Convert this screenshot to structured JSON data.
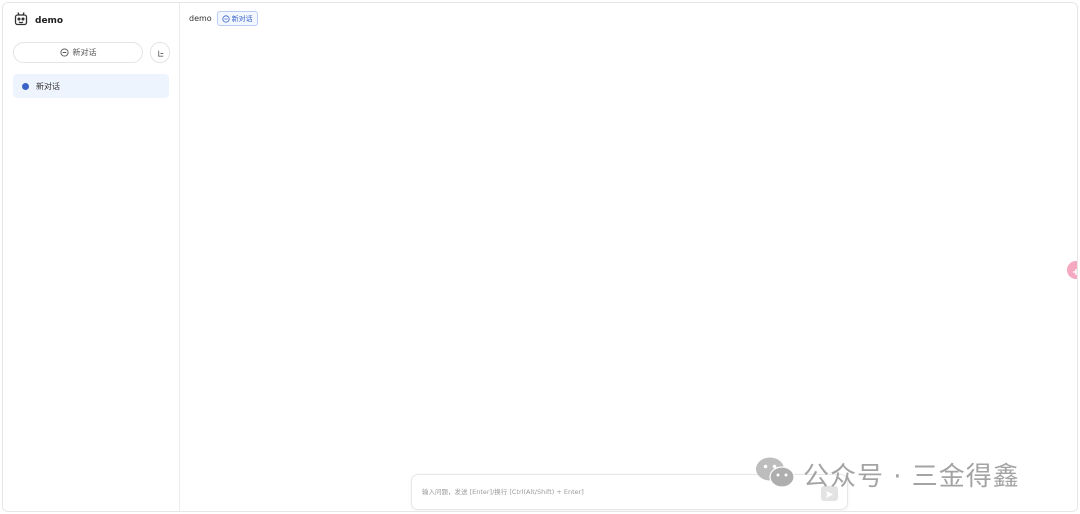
{
  "app": {
    "name": "demo",
    "logo_icon": "robot-icon"
  },
  "sidebar": {
    "new_chat_label": "新对话",
    "new_chat_icon": "chat-plus-icon",
    "collapse_icon": "sidebar-toggle-icon",
    "conversations": [
      {
        "label": "新对话",
        "active": true
      }
    ]
  },
  "header": {
    "title": "demo",
    "tag_label": "新对话",
    "tag_icon": "chat-plus-icon"
  },
  "composer": {
    "placeholder": "输入问题，发送 [Enter]/换行 [Ctrl(Alt/Shift) + Enter]",
    "send_icon": "send-icon"
  },
  "watermark": {
    "text": "公众号 · 三金得鑫",
    "icon": "wechat-icon"
  },
  "colors": {
    "accent": "#3a63c7",
    "active_bg": "#eef4fd",
    "handle": "#f4a9c0"
  }
}
